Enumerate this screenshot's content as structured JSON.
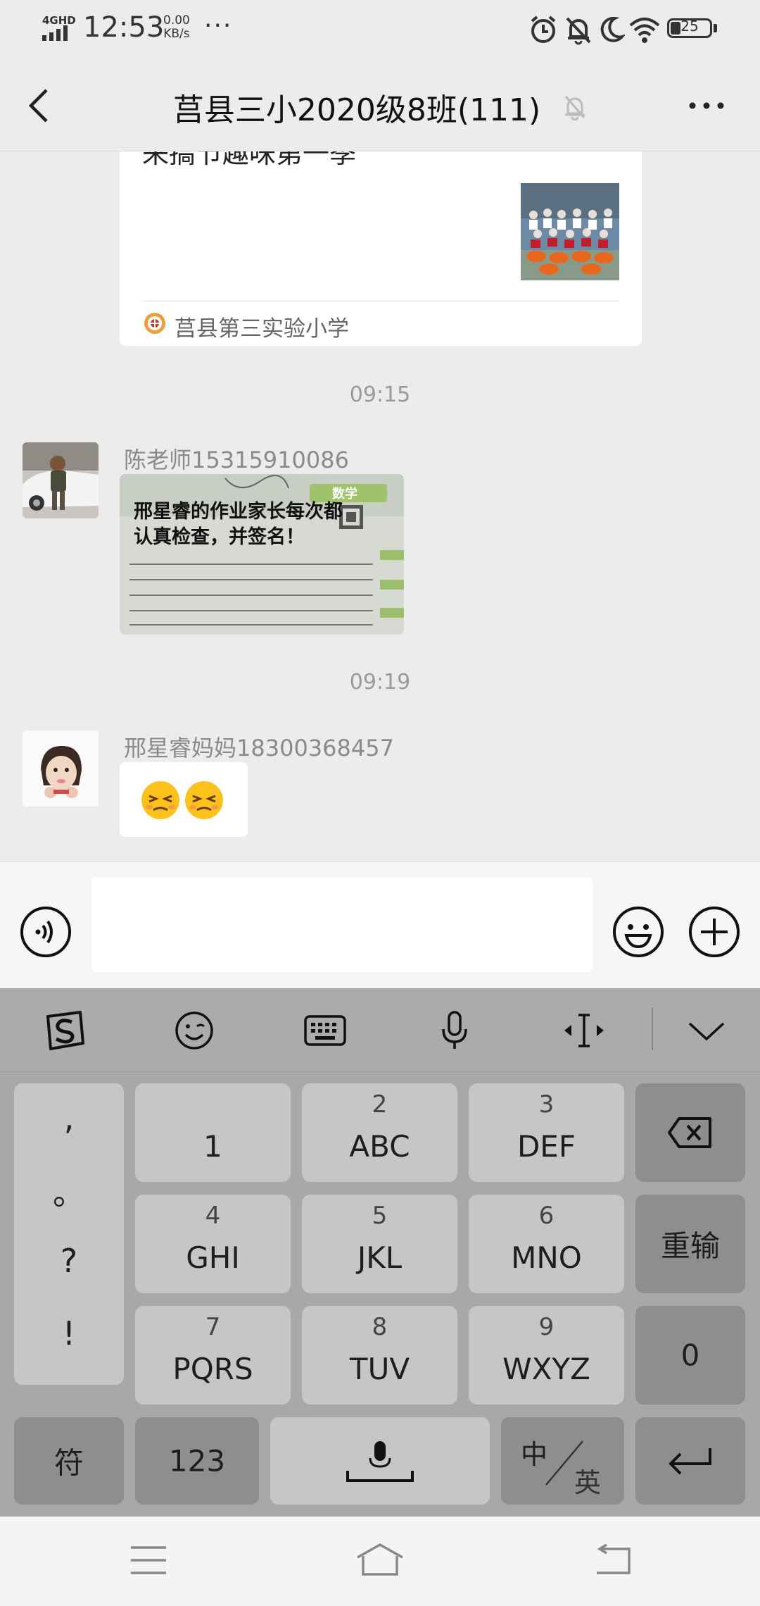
{
  "status_bar": {
    "network": "4GHD",
    "time": "12:53",
    "speed_value": "0.00",
    "speed_unit": "KB/s",
    "more": "···",
    "battery": "25",
    "icons": [
      "alarm-icon",
      "bell-off-icon",
      "moon-icon",
      "wifi-icon",
      "battery-icon"
    ]
  },
  "header": {
    "title": "莒县三小2020级8班(111)",
    "icons": [
      "back-arrow-icon",
      "mute-bell-icon",
      "more-icon"
    ]
  },
  "chat": {
    "card": {
      "title": "来搞节趣味第一季",
      "source": "莒县第三实验小学"
    },
    "messages": [
      {
        "time": "09:15",
        "sender": "陈老师15315910086",
        "image_caption": "邢星睿的作业家长每次都认真检查，并签名！",
        "image_caption_line1": "邢星睿的作业家长每次都",
        "image_caption_line2": "认真检查，并签名！"
      },
      {
        "time": "09:19",
        "sender": "邢星睿妈妈18300368457",
        "content": "😣😣"
      }
    ]
  },
  "input_bar": {
    "placeholder": "",
    "icons": [
      "voice-icon",
      "emoji-icon",
      "plus-icon"
    ]
  },
  "keyboard": {
    "toolbar_icons": [
      "sogou-logo-icon",
      "emoji-face-icon",
      "keyboard-icon",
      "microphone-icon",
      "cursor-move-icon",
      "collapse-chevron-icon"
    ],
    "punctuation": [
      ",",
      "。",
      "?",
      "!"
    ],
    "keys": [
      {
        "num": "",
        "letters": "1"
      },
      {
        "num": "2",
        "letters": "ABC"
      },
      {
        "num": "3",
        "letters": "DEF"
      },
      {
        "num": "4",
        "letters": "GHI"
      },
      {
        "num": "5",
        "letters": "JKL"
      },
      {
        "num": "6",
        "letters": "MNO"
      },
      {
        "num": "7",
        "letters": "PQRS"
      },
      {
        "num": "8",
        "letters": "TUV"
      },
      {
        "num": "9",
        "letters": "WXYZ"
      }
    ],
    "reenter": "重输",
    "zero": "0",
    "symbols": "符",
    "numbers": "123",
    "zh": "中",
    "en": "英"
  },
  "nav_bar": {
    "icons": [
      "menu-icon",
      "home-icon",
      "back-icon"
    ]
  }
}
